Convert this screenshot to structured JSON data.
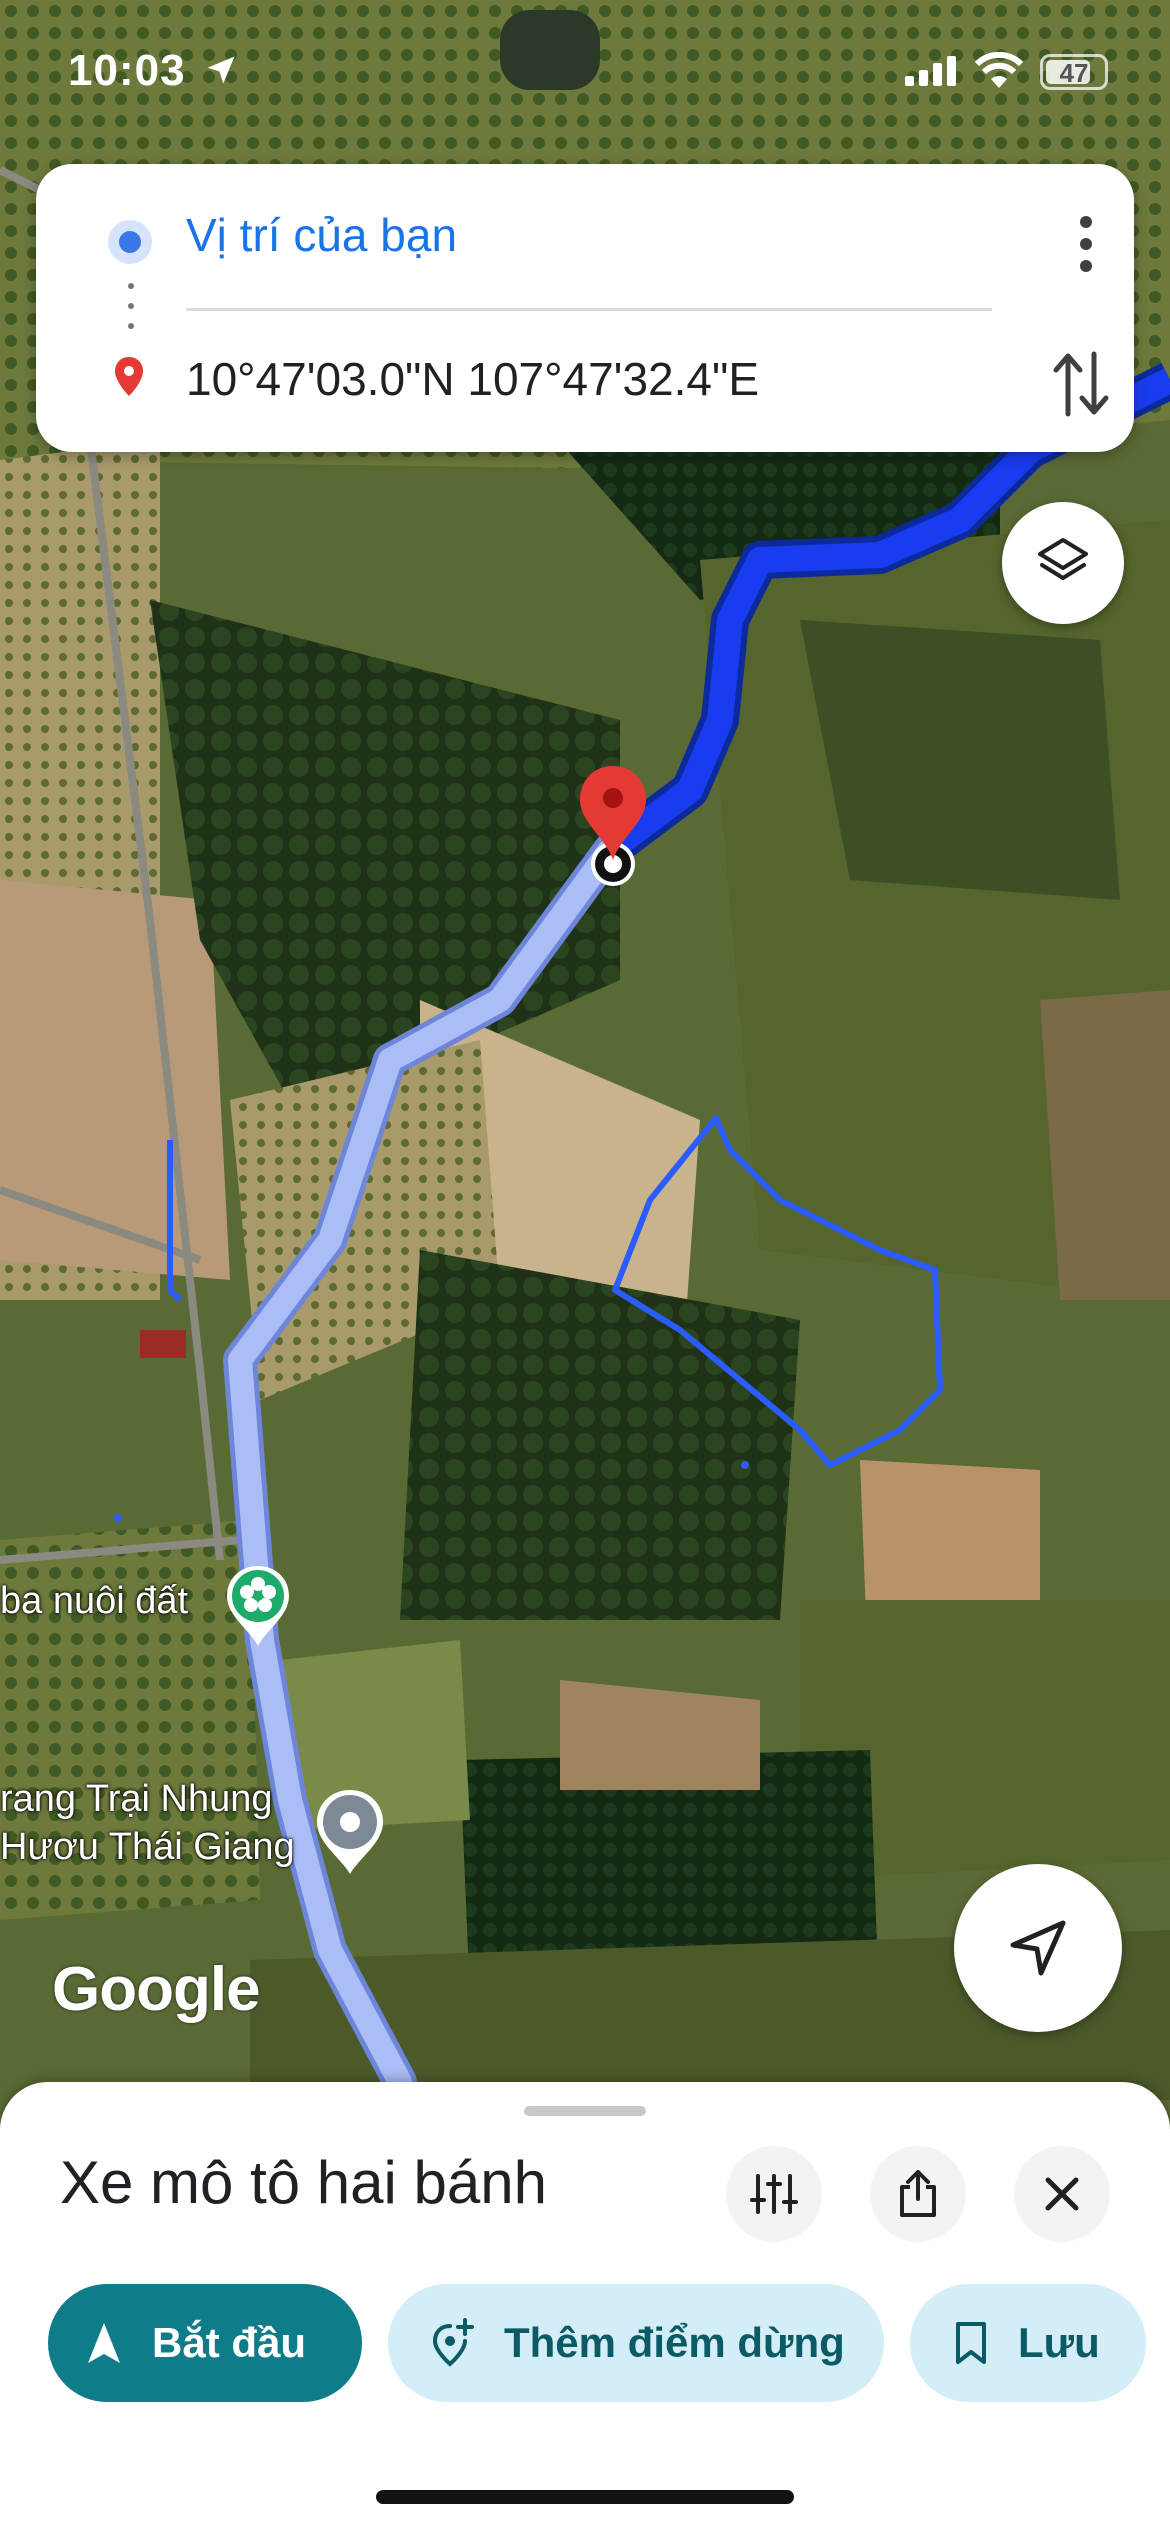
{
  "status_bar": {
    "time": "10:03",
    "battery": "47"
  },
  "route": {
    "origin": "Vị trí của bạn",
    "destination": "10°47'03.0\"N 107°47'32.4\"E"
  },
  "map": {
    "labels": {
      "poi_1": "ba nuôi đất",
      "poi_2_line1": "rang Trại Nhung",
      "poi_2_line2": "Hươu Thái Giang"
    },
    "logo": "Google",
    "colors": {
      "active_route": "#1a3cf0",
      "traveled_route": "#a9bdf5",
      "destination_pin": "#e53935"
    }
  },
  "sheet": {
    "mode_title": "Xe mô tô hai bánh",
    "buttons": {
      "start": "Bắt đầu",
      "add_stop": "Thêm điểm dừng",
      "save": "Lưu"
    }
  }
}
